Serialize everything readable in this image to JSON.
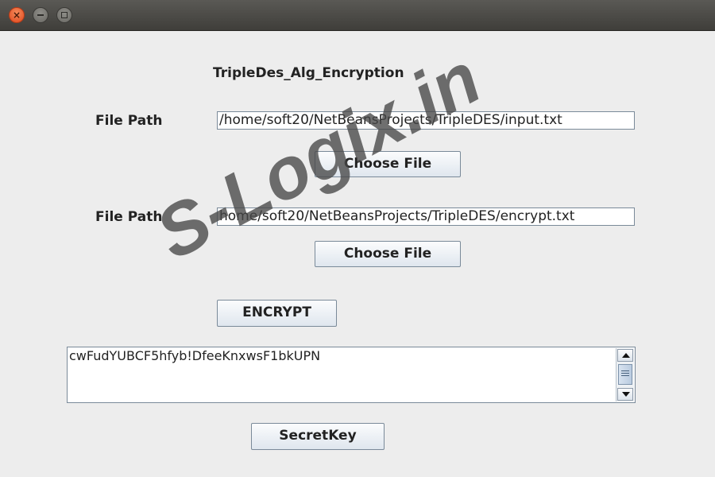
{
  "window": {
    "close_glyph": "×"
  },
  "form": {
    "heading": "TripleDes_Alg_Encryption",
    "input_label": "File Path",
    "input_path": "/home/soft20/NetBeansProjects/TripleDES/input.txt",
    "input_choose_label": "Choose File",
    "output_label": "File Path",
    "output_path": "home/soft20/NetBeansProjects/TripleDES/encrypt.txt",
    "output_choose_label": "Choose File",
    "encrypt_label": "ENCRYPT",
    "result_text": "cwFudYUBCF5hfyb!DfeeKnxwsF1bkUPN",
    "secret_key_label": "SecretKey"
  },
  "watermark": {
    "text": "S-Logix.in",
    "color": "#464646"
  }
}
